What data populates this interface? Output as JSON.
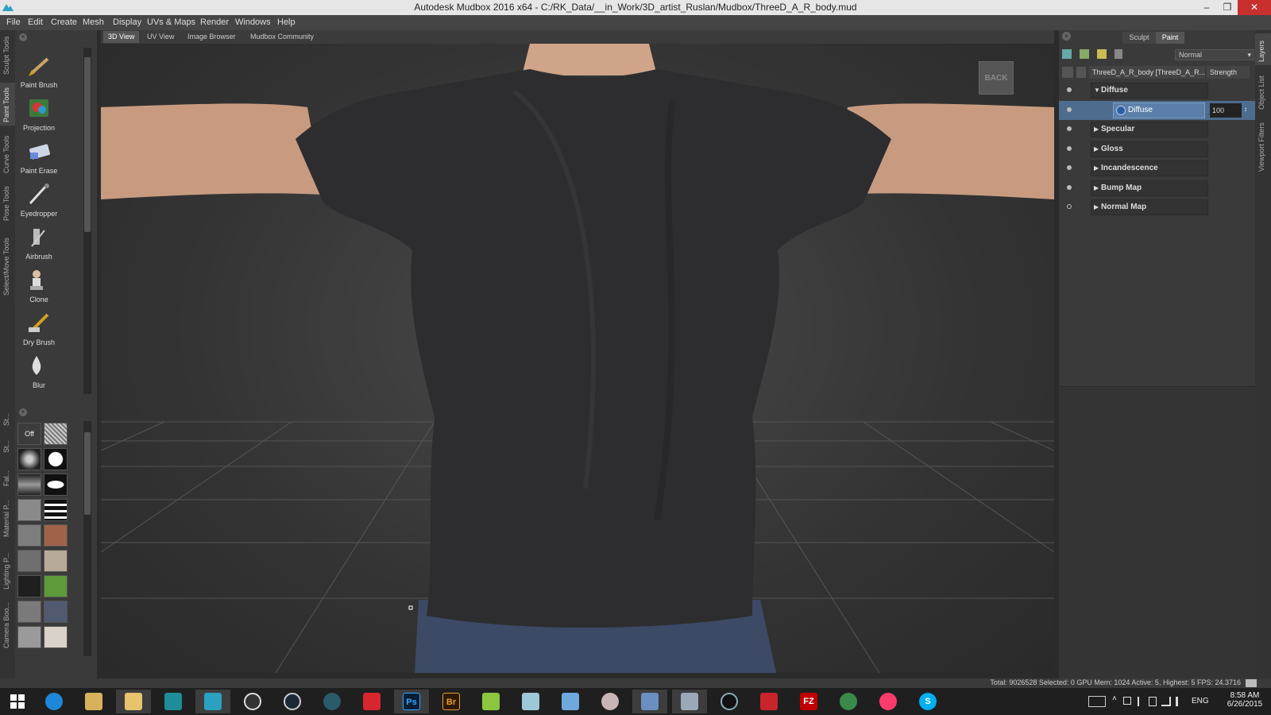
{
  "window": {
    "title": "Autodesk Mudbox 2016 x64 - C:/RK_Data/__in_Work/3D_artist_Ruslan/Mudbox/ThreeD_A_R_body.mud",
    "controls": [
      "–",
      "❐",
      "✕"
    ]
  },
  "menu": [
    "File",
    "Edit",
    "Create",
    "Mesh",
    "Display",
    "UVs & Maps",
    "Render",
    "Windows",
    "Help"
  ],
  "left_tabs": [
    "Sculpt Tools",
    "Paint Tools",
    "Curve Tools",
    "Pose Tools",
    "Select/Move Tools"
  ],
  "left_lower_tabs": [
    "St...",
    "St...",
    "Fal...",
    "Material P...",
    "Lighting P...",
    "Camera Boo..."
  ],
  "tools": [
    {
      "label": "Paint Brush",
      "icon": "paint-brush-icon"
    },
    {
      "label": "Projection",
      "icon": "projection-icon"
    },
    {
      "label": "Paint Erase",
      "icon": "paint-erase-icon"
    },
    {
      "label": "Eyedropper",
      "icon": "eyedropper-icon"
    },
    {
      "label": "Airbrush",
      "icon": "airbrush-icon"
    },
    {
      "label": "Clone",
      "icon": "clone-icon"
    },
    {
      "label": "Dry Brush",
      "icon": "dry-brush-icon"
    },
    {
      "label": "Blur",
      "icon": "blur-icon"
    }
  ],
  "stamp_off_label": "Off",
  "view_tabs": [
    "3D View",
    "UV View",
    "Image Browser",
    "Mudbox Community"
  ],
  "viewport": {
    "back_label": "BACK"
  },
  "right_panel": {
    "tabs": [
      "Sculpt",
      "Paint"
    ],
    "blend_mode": "Normal",
    "object_label": "ThreeD_A_R_body [ThreeD_A_R...",
    "strength_label": "Strength",
    "layers": [
      {
        "label": "Diffuse",
        "expanded": true
      },
      {
        "label": "Diffuse",
        "sublayer": true,
        "value": "100"
      },
      {
        "label": "Specular"
      },
      {
        "label": "Gloss"
      },
      {
        "label": "Incandescence"
      },
      {
        "label": "Bump Map"
      },
      {
        "label": "Normal Map"
      }
    ]
  },
  "right_tabs": [
    "Layers",
    "Object List",
    "Viewport Filters"
  ],
  "status": "Total: 9026528  Selected: 0 GPU Mem: 1024  Active: 5, Highest: 5  FPS: 24.3716",
  "taskbar": {
    "apps": [
      "windows-start",
      "internet-explorer",
      "file-explorer",
      "folder",
      "maya-lt",
      "mudbox",
      "obs",
      "steam",
      "ccleaner",
      "creative-cloud",
      "photoshop",
      "bridge",
      "file-manager",
      "notes",
      "calculator",
      "paint",
      "remote-desktop",
      "image-viewer",
      "screen-recorder",
      "pdf-reader",
      "filezilla",
      "globe-app",
      "itunes",
      "skype"
    ],
    "ps_label": "Ps",
    "br_label": "Br",
    "fz_label": "FZ",
    "skype_label": "S",
    "lang": "ENG",
    "time": "8:58 AM",
    "date": "6/26/2015"
  }
}
